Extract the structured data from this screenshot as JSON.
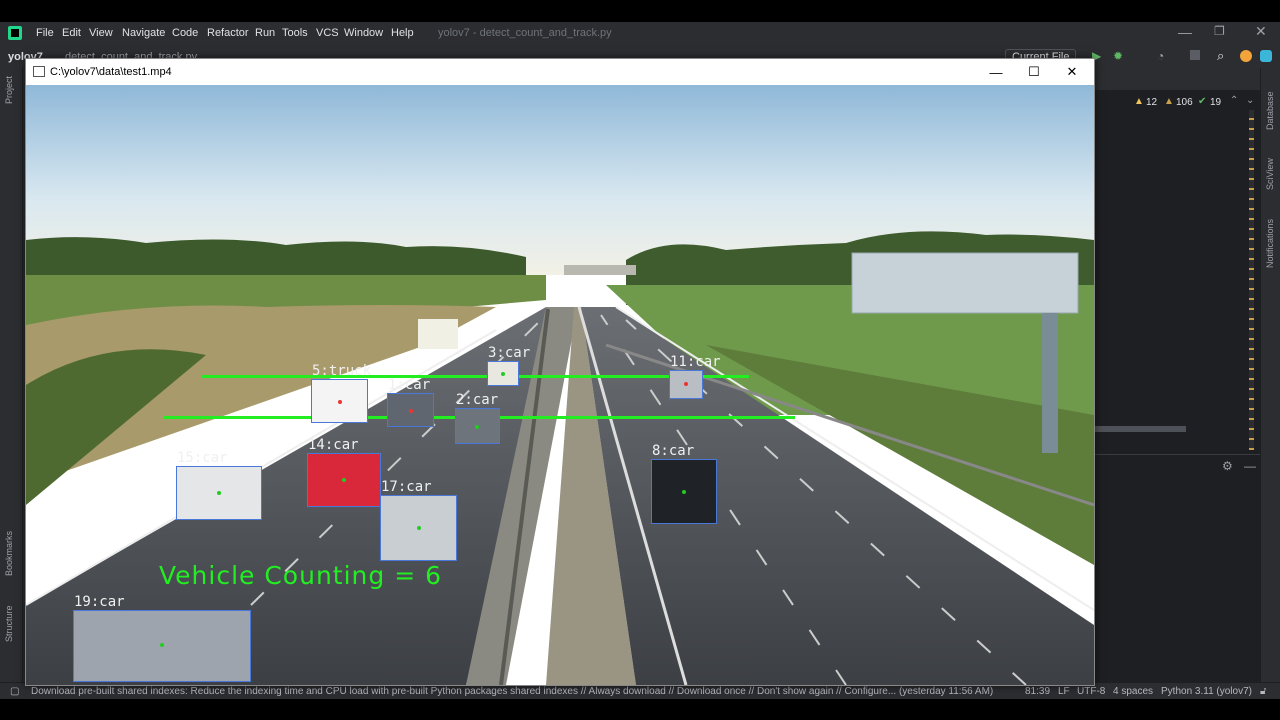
{
  "menu": {
    "items": [
      "File",
      "Edit",
      "View",
      "Navigate",
      "Code",
      "Refactor",
      "Run",
      "Tools",
      "VCS",
      "Window",
      "Help"
    ],
    "title": "yolov7 - detect_count_and_track.py"
  },
  "project": {
    "name": "yolov7",
    "file": "detect_count_and_track.py",
    "run_config": "Current File"
  },
  "inspections": {
    "errors": "12",
    "warnings": "106",
    "ok": "19"
  },
  "side_tools": {
    "left": [
      "Project",
      "Bookmarks",
      "Structure"
    ],
    "right": [
      "Database",
      "SciView",
      "Notifications"
    ]
  },
  "video": {
    "window_title": "C:\\yolov7\\data\\test1.mp4",
    "counter_text": "Vehicle Counting = 6",
    "detections": [
      {
        "label": "5:truck"
      },
      {
        "label": "1:car"
      },
      {
        "label": "3:car"
      },
      {
        "label": "2:car"
      },
      {
        "label": "11:car"
      },
      {
        "label": "14:car"
      },
      {
        "label": "15:car"
      },
      {
        "label": "17:car"
      },
      {
        "label": "8:car"
      },
      {
        "label": "19:car"
      }
    ]
  },
  "statusbar": {
    "message": "Download pre-built shared indexes: Reduce the indexing time and CPU load with pre-built Python packages shared indexes // Always download // Download once // Don't show again // Configure... (yesterday 11:56 AM)",
    "position": "81:39",
    "line_sep": "LF",
    "encoding": "UTF-8",
    "indent": "4 spaces",
    "interpreter": "Python 3.11 (yolov7)"
  },
  "colors": {
    "ide_bg": "#2b2d30",
    "line": "#22ee22",
    "box": "#4a78d8",
    "counter": "#22ee22"
  }
}
